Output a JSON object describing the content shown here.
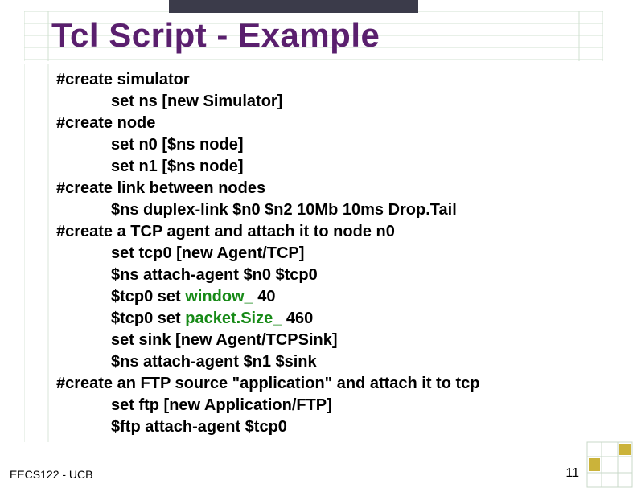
{
  "title": "Tcl Script - Example",
  "colors": {
    "title": "#5a1f6e",
    "highlight_green": "#178a17",
    "topbar": "#3b3b4a",
    "grid_line": "#c8d8c8"
  },
  "code": {
    "c01": "#create simulator",
    "c02": "set ns [new Simulator]",
    "c03": "#create node",
    "c04": "set n0 [$ns node]",
    "c05": "set n1 [$ns node]",
    "c06": "#create link between nodes",
    "c07": "$ns duplex-link $n0 $n2 10Mb 10ms Drop.Tail",
    "c08": "#create a TCP agent and attach it to node n0",
    "c09": "set tcp0 [new Agent/TCP]",
    "c10": "$ns attach-agent $n0 $tcp0",
    "c11a": "$tcp0 set ",
    "c11b": "window_",
    "c11c": " 40",
    "c12a": "$tcp0 set ",
    "c12b": "packet.Size_",
    "c12c": " 460",
    "c13": "set sink [new Agent/TCPSink]",
    "c14": "$ns attach-agent $n1 $sink",
    "c15": "#create an FTP source \"application\" and attach it to tcp",
    "c16": "set ftp [new Application/FTP]",
    "c17": "$ftp attach-agent $tcp0"
  },
  "footer": {
    "left": "EECS122 - UCB",
    "right": "11"
  }
}
